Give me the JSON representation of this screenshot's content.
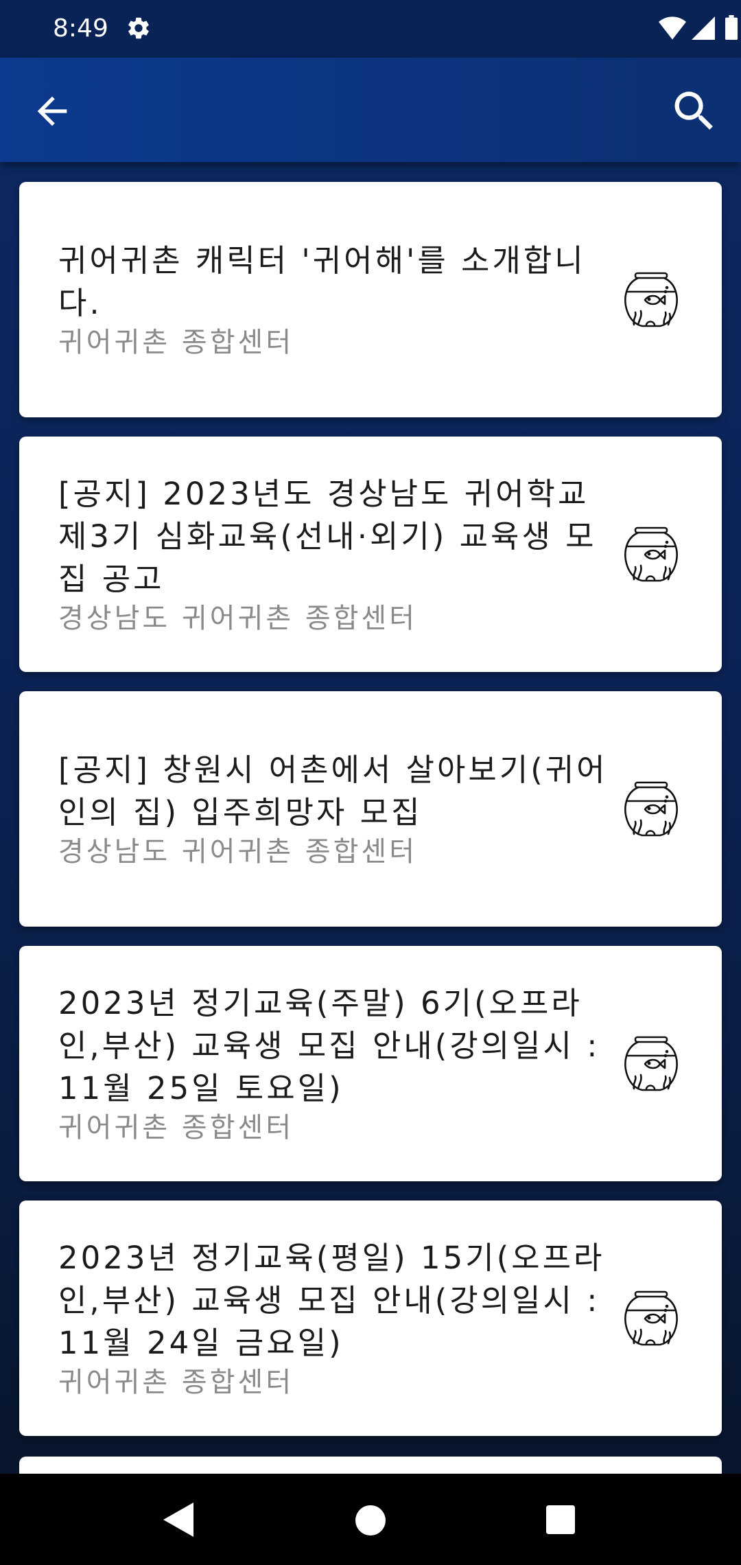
{
  "status_bar": {
    "time": "8:49",
    "icons": [
      "gear-icon",
      "wifi-icon",
      "signal-icon",
      "battery-icon"
    ]
  },
  "app_bar": {
    "back_icon": "arrow-left-icon",
    "search_icon": "search-icon"
  },
  "posts": [
    {
      "title": "귀어귀촌 캐릭터 '귀어해'를 소개합니다.",
      "source": "귀어귀촌 종합센터",
      "icon": "fishbowl-icon"
    },
    {
      "title": "[공지] 2023년도 경상남도 귀어학교 제3기 심화교육(선내·외기) 교육생 모집 공고",
      "source": "경상남도 귀어귀촌 종합센터",
      "icon": "fishbowl-icon"
    },
    {
      "title": "[공지] 창원시 어촌에서 살아보기(귀어인의 집) 입주희망자 모집",
      "source": "경상남도 귀어귀촌 종합센터",
      "icon": "fishbowl-icon"
    },
    {
      "title": "2023년 정기교육(주말) 6기(오프라인,부산) 교육생 모집 안내(강의일시 : 11월 25일 토요일)",
      "source": "귀어귀촌 종합센터",
      "icon": "fishbowl-icon"
    },
    {
      "title": "2023년 정기교육(평일) 15기(오프라인,부산) 교육생 모집 안내(강의일시 : 11월 24일 금요일)",
      "source": "귀어귀촌 종합센터",
      "icon": "fishbowl-icon"
    }
  ],
  "nav_bar": {
    "icons": [
      "nav-back-icon",
      "nav-home-icon",
      "nav-recents-icon"
    ]
  },
  "colors": {
    "app_bar": "#0d3a8e",
    "background_top": "#0c2a63",
    "title_text": "#1b1b1b",
    "source_text": "#8a8a8a"
  }
}
